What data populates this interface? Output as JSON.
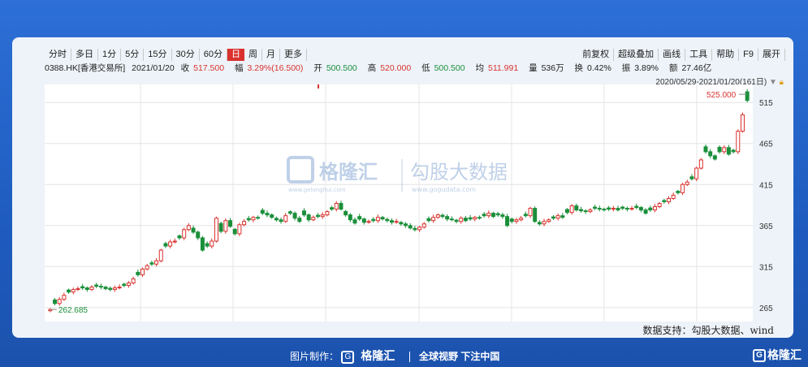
{
  "toolbar": {
    "left": [
      "分时",
      "多日",
      "1分",
      "5分",
      "15分",
      "30分",
      "60分",
      "日",
      "周",
      "月",
      "更多"
    ],
    "active": "日",
    "right": [
      "前复权",
      "超级叠加",
      "画线",
      "工具",
      "帮助",
      "F9",
      "展开"
    ]
  },
  "info": {
    "code": "0388.HK[香港交易所]",
    "date": "2021/01/20",
    "close_label": "收",
    "close": "517.500",
    "change_label": "幅",
    "change": "3.29%(16.500)",
    "open_label": "开",
    "open": "500.500",
    "high_label": "高",
    "high": "520.000",
    "low_label": "低",
    "low": "500.500",
    "avg_label": "均",
    "avg": "511.991",
    "volume_label": "量",
    "volume": "536万",
    "turnover_label": "换",
    "turnover": "0.42%",
    "amplitude_label": "振",
    "amplitude": "3.89%",
    "amount_label": "额",
    "amount": "27.46亿"
  },
  "date_range": "2020/05/29-2021/01/20(161日)",
  "watermark": {
    "logo": "格隆汇",
    "logo_url": "www.gelonghui.com",
    "text": "勾股大数据",
    "text_url": "www.gogudata.com"
  },
  "source": "数据支持：勾股大数据、wind",
  "footer": {
    "prefix": "图片制作：",
    "logo": "格隆汇",
    "slogan": "全球视野 下注中国",
    "brand": "格隆汇"
  },
  "colors": {
    "up": "#d9322e",
    "down": "#1a8f3a",
    "grid": "#e4e4e4"
  },
  "chart_data": {
    "type": "candlestick",
    "x_start": "2020/05/29",
    "x_end": "2021/01/20",
    "ylim": [
      248,
      537
    ],
    "yticks": [
      265,
      315,
      365,
      415,
      465,
      515
    ],
    "grid": true,
    "annotations": {
      "max": "525.000",
      "min": "262.685"
    },
    "closes": [
      262.7,
      270,
      275,
      280,
      284,
      287,
      288,
      289,
      287,
      290,
      291,
      290,
      288,
      287,
      289,
      290,
      292,
      295,
      300,
      305,
      312,
      316,
      318,
      322,
      335,
      340,
      345,
      346,
      350,
      360,
      365,
      357,
      350,
      335,
      340,
      346,
      374,
      358,
      371,
      364,
      355,
      366,
      370,
      372,
      375,
      374,
      380,
      378,
      375,
      372,
      370,
      377,
      380,
      374,
      370,
      378,
      372,
      375,
      376,
      378,
      382,
      385,
      392,
      385,
      378,
      372,
      368,
      373,
      369,
      370,
      371,
      375,
      373,
      371,
      369,
      370,
      367,
      365,
      362,
      360,
      363,
      367,
      371,
      375,
      378,
      376,
      373,
      372,
      370,
      374,
      371,
      373,
      375,
      374,
      377,
      380,
      376,
      378,
      376,
      365,
      370,
      372,
      374,
      377,
      386,
      370,
      367,
      370,
      372,
      374,
      377,
      375,
      381,
      389,
      384,
      383,
      382,
      384,
      386,
      385,
      384,
      385,
      386,
      384,
      386,
      385,
      386,
      387,
      384,
      380,
      384,
      388,
      392,
      394,
      398,
      402,
      405,
      415,
      418,
      422,
      435,
      445,
      455,
      450,
      446,
      455,
      460,
      452,
      455,
      480,
      500,
      517.5
    ]
  }
}
